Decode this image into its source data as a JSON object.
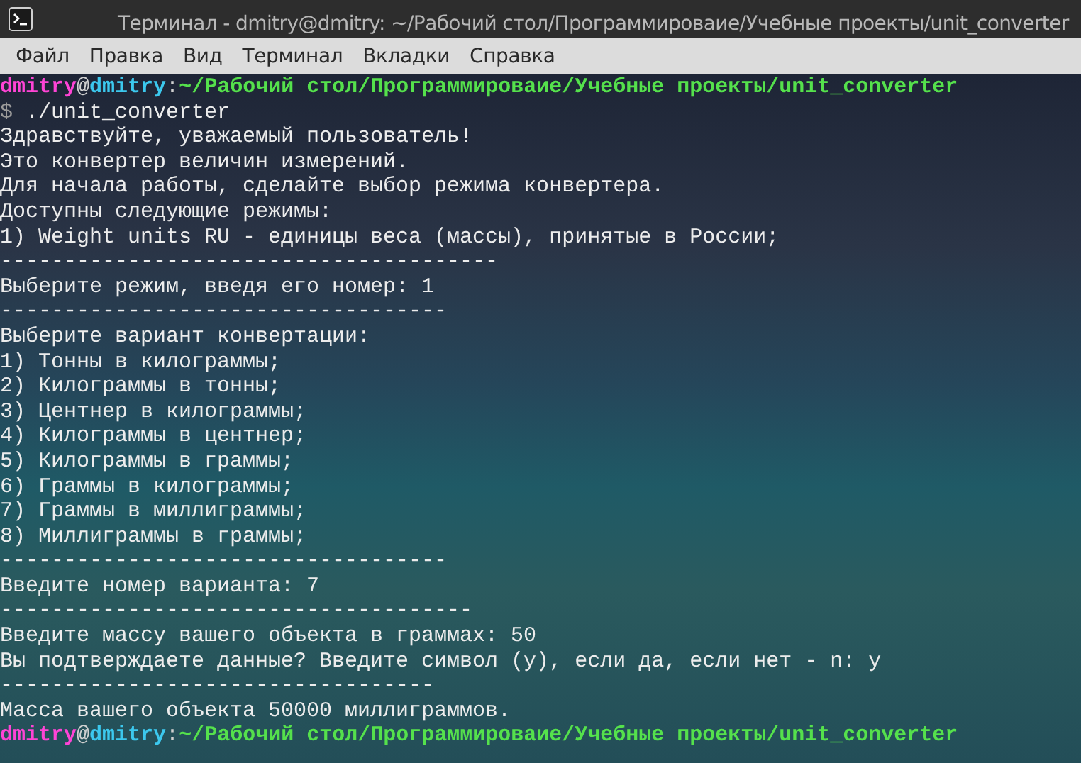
{
  "window": {
    "title": "Терминал - dmitry@dmitry: ~/Рабочий стол/Программироваие/Учебные проекты/unit_converter"
  },
  "menu": [
    "Файл",
    "Правка",
    "Вид",
    "Терминал",
    "Вкладки",
    "Справка"
  ],
  "lines": [
    {
      "kind": "prompt",
      "user": "dmitry",
      "at": "@",
      "host": "dmitry",
      "colon": ":",
      "path": "~/Рабочий стол/Программироваие/Учебные проекты/unit_converter"
    },
    {
      "kind": "command",
      "symbol": "$",
      "text": "./unit_converter"
    },
    {
      "kind": "output",
      "text": "Здравствуйте, уважаемый пользователь!"
    },
    {
      "kind": "output",
      "text": "Это конвертер величин измерений."
    },
    {
      "kind": "output",
      "text": "Для начала работы, сделайте выбор режима конвертера."
    },
    {
      "kind": "output",
      "text": "Доступны следующие режимы:"
    },
    {
      "kind": "output",
      "text": "1) Weight units RU - единицы веса (массы), принятые в России;"
    },
    {
      "kind": "output",
      "text": "---------------------------------------"
    },
    {
      "kind": "output",
      "text": "Выберите режим, введя его номер: 1"
    },
    {
      "kind": "output",
      "text": "-----------------------------------"
    },
    {
      "kind": "output",
      "text": "Выберите вариант конвертации:"
    },
    {
      "kind": "output",
      "text": "1) Тонны в килограммы;"
    },
    {
      "kind": "output",
      "text": "2) Килограммы в тонны;"
    },
    {
      "kind": "output",
      "text": "3) Центнер в килограммы;"
    },
    {
      "kind": "output",
      "text": "4) Килограммы в центнер;"
    },
    {
      "kind": "output",
      "text": "5) Килограммы в граммы;"
    },
    {
      "kind": "output",
      "text": "6) Граммы в килограммы;"
    },
    {
      "kind": "output",
      "text": "7) Граммы в миллиграммы;"
    },
    {
      "kind": "output",
      "text": "8) Миллиграммы в граммы;"
    },
    {
      "kind": "output",
      "text": "-----------------------------------"
    },
    {
      "kind": "output",
      "text": "Введите номер варианта: 7"
    },
    {
      "kind": "output",
      "text": "-------------------------------------"
    },
    {
      "kind": "output",
      "text": "Введите массу вашего объекта в граммах: 50"
    },
    {
      "kind": "output",
      "text": "Вы подтверждаете данные? Введите символ (y), если да, если нет - n: y"
    },
    {
      "kind": "output",
      "text": "----------------------------------"
    },
    {
      "kind": "output",
      "text": "Масса вашего объекта 50000 миллиграммов."
    },
    {
      "kind": "prompt",
      "user": "dmitry",
      "at": "@",
      "host": "dmitry",
      "colon": ":",
      "path": "~/Рабочий стол/Программироваие/Учебные проекты/unit_converter"
    }
  ]
}
